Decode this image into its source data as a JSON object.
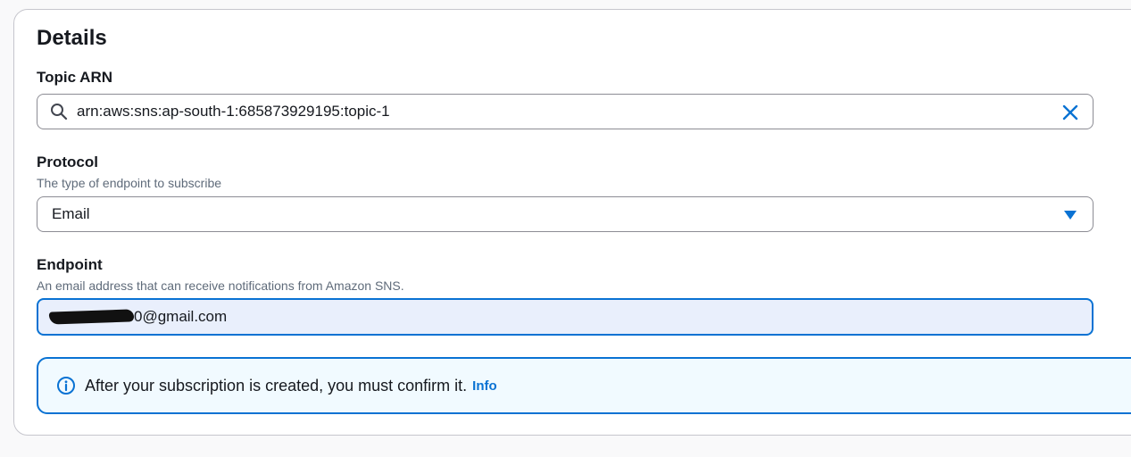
{
  "details": {
    "title": "Details",
    "topic_arn": {
      "label": "Topic ARN",
      "value": "arn:aws:sns:ap-south-1:685873929195:topic-1",
      "icon": "search-icon",
      "clear_icon": "close-icon"
    },
    "protocol": {
      "label": "Protocol",
      "description": "The type of endpoint to subscribe",
      "selected": "Email",
      "icon": "caret-down-icon"
    },
    "endpoint": {
      "label": "Endpoint",
      "description": "An email address that can receive notifications from Amazon SNS.",
      "value_visible_suffix": "0@gmail.com"
    },
    "alert": {
      "message": "After your subscription is created, you must confirm it.",
      "link": "Info",
      "icon": "info-icon"
    }
  },
  "colors": {
    "accent": "#0972d3",
    "alert_background": "#f1faff",
    "focused_input_background": "#e9effc"
  }
}
